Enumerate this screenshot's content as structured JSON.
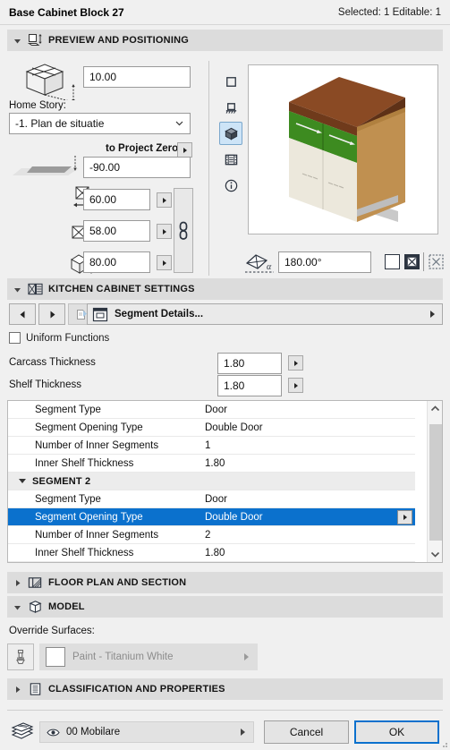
{
  "window": {
    "title": "Base Cabinet Block 27",
    "selection_status": "Selected: 1 Editable: 1"
  },
  "sections": {
    "preview": {
      "title": "PREVIEW AND POSITIONING",
      "expanded": true,
      "icon": "preview-positioning-icon"
    },
    "kitchen": {
      "title": "KITCHEN CABINET SETTINGS",
      "expanded": true,
      "icon": "kitchen-cabinet-icon"
    },
    "floorplan": {
      "title": "FLOOR PLAN AND SECTION",
      "expanded": false,
      "icon": "floor-plan-section-icon"
    },
    "model": {
      "title": "MODEL",
      "expanded": true,
      "icon": "model-cube-icon"
    },
    "classification": {
      "title": "CLASSIFICATION AND PROPERTIES",
      "expanded": false,
      "icon": "classification-icon"
    }
  },
  "positioning": {
    "elevation_to_home_story": "10.00",
    "home_story_label": "Home Story:",
    "home_story_value": "-1. Plan de situatie",
    "to_project_zero_label": "to Project Zero",
    "to_project_zero_value": "-90.00",
    "width": "60.00",
    "depth": "58.00",
    "height": "80.00",
    "angle": "180.00°"
  },
  "preview_toolbar": {
    "items": [
      {
        "name": "2d-symbol-view",
        "icon": "square-icon",
        "active": false
      },
      {
        "name": "elevation-view",
        "icon": "elevation-icon",
        "active": false
      },
      {
        "name": "3d-view",
        "icon": "cube-icon",
        "active": true
      },
      {
        "name": "list-view",
        "icon": "filmstrip-icon",
        "active": false
      },
      {
        "name": "info-view",
        "icon": "info-icon",
        "active": false
      }
    ]
  },
  "preview_options": {
    "checkbox_1": false,
    "checkbox_2": true,
    "checkbox_3": false
  },
  "kitchen": {
    "nav_prev": "◀",
    "nav_next": "▶",
    "segment_details_label": "Segment Details...",
    "uniform_functions_label": "Uniform Functions",
    "uniform_functions_checked": false,
    "carcass_thickness_label": "Carcass Thickness",
    "carcass_thickness_value": "1.80",
    "shelf_thickness_label": "Shelf Thickness",
    "shelf_thickness_value": "1.80"
  },
  "list": {
    "rows": [
      {
        "type": "item",
        "name": "Segment Type",
        "value": "Door",
        "selected": false
      },
      {
        "type": "item",
        "name": "Segment Opening Type",
        "value": "Double Door",
        "selected": false
      },
      {
        "type": "item",
        "name": "Number of Inner Segments",
        "value": "1",
        "selected": false
      },
      {
        "type": "item",
        "name": "Inner Shelf Thickness",
        "value": "1.80",
        "selected": false
      },
      {
        "type": "group",
        "name": "SEGMENT 2",
        "value": "",
        "selected": false
      },
      {
        "type": "item",
        "name": "Segment Type",
        "value": "Door",
        "selected": false
      },
      {
        "type": "item",
        "name": "Segment Opening Type",
        "value": "Double Door",
        "selected": true
      },
      {
        "type": "item",
        "name": "Number of Inner Segments",
        "value": "2",
        "selected": false
      },
      {
        "type": "item",
        "name": "Inner Shelf Thickness",
        "value": "1.80",
        "selected": false
      }
    ]
  },
  "model": {
    "override_surfaces_label": "Override Surfaces:",
    "surface_value": "Paint - Titanium White",
    "surface_enabled": false
  },
  "footer": {
    "layer_value": "00 Mobilare",
    "cancel_label": "Cancel",
    "ok_label": "OK"
  },
  "colors": {
    "accent": "#0b71cd",
    "section_header_bg": "#dcdcdc",
    "panel_bg": "#f0f0f0",
    "cabinet_top": "#8a4a24",
    "cabinet_band": "#3d8b20",
    "cabinet_door": "#ece8dc",
    "cabinet_side": "#c09050"
  }
}
